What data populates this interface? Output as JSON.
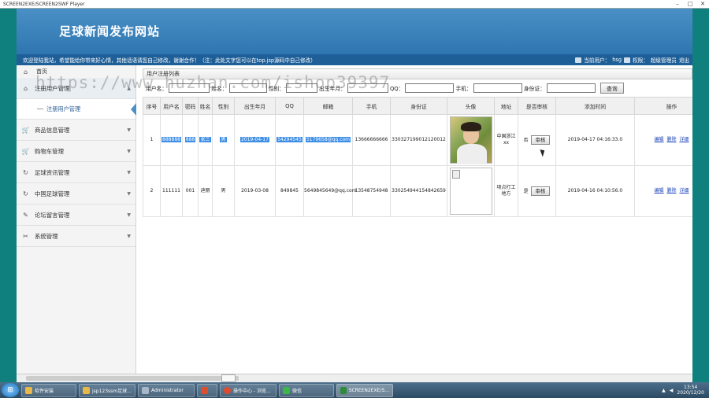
{
  "player": {
    "title": "SCREEN2EXE/SCREEN2SWF Player",
    "controls": [
      "–",
      "□",
      "✕"
    ]
  },
  "app": {
    "title": "足球新闻发布网站",
    "notice": "欢迎登陆我站，希望能给你带来好心情，其他话语请您自己修改，谢谢合作！（注：此处文字您可以在top.jsp源码中自己修改）",
    "current_user_label": "当前用户：",
    "current_user": "hsg",
    "permission_label": "权限：",
    "permission": "超级管理员",
    "logout": "退出"
  },
  "sidebar": {
    "home": "首页",
    "items": [
      {
        "label": "注册用户管理",
        "icon": "home-icon",
        "expanded": true
      },
      {
        "label": "商品信息管理",
        "icon": "cart-icon"
      },
      {
        "label": "购物车管理",
        "icon": "cart-icon"
      },
      {
        "label": "足球资讯管理",
        "icon": "refresh-icon"
      },
      {
        "label": "中国足球管理",
        "icon": "refresh-icon"
      },
      {
        "label": "论坛留言管理",
        "icon": "edit-icon"
      },
      {
        "label": "系统管理",
        "icon": "tools-icon"
      }
    ],
    "sub_item": "注册用户管理"
  },
  "main": {
    "panel_title": "用户注册列表",
    "search": {
      "fields": [
        {
          "label": "用户名：",
          "value": ""
        },
        {
          "label": "姓名：",
          "value": ""
        },
        {
          "label": "性别：",
          "value": ""
        },
        {
          "label": "出生年月：",
          "value": ""
        },
        {
          "label": "QQ：",
          "value": ""
        },
        {
          "label": "手机：",
          "value": ""
        },
        {
          "label": "身份证：",
          "value": ""
        }
      ],
      "button": "查询"
    },
    "columns": [
      "序号",
      "用户名",
      "密码",
      "姓名",
      "性别",
      "出生年月",
      "QQ",
      "邮箱",
      "手机",
      "身份证",
      "头像",
      "地址",
      "是否审核",
      "添加时间",
      "操作"
    ],
    "rows": [
      {
        "no": "1",
        "username": "888888",
        "password": "888",
        "name": "张三",
        "gender": "男",
        "birth": "2019-04-17",
        "qq": "54294545",
        "email": "5179658@qq.com",
        "phone": "13666666666",
        "idcard": "330327199012120012",
        "address": "中国浙江xx",
        "audit": "否",
        "audit_btn": "审核",
        "added": "2019-04-17 04:16:33.0",
        "actions": [
          "编辑",
          "删除",
          "详细"
        ]
      },
      {
        "no": "2",
        "username": "111111",
        "password": "001",
        "name": "迪丽",
        "gender": "男",
        "birth": "2019-03-08",
        "qq": "849845",
        "email": "5649845649@qq.com",
        "phone": "13548754948",
        "idcard": "330254944154842659",
        "address": "项点打工地方",
        "audit": "是",
        "audit_btn": "审核",
        "added": "2019-04-16 04:10:56.0",
        "actions": [
          "编辑",
          "删除",
          "详细"
        ]
      }
    ]
  },
  "watermark": "https://www.huzhan.com/ishop39397",
  "taskbar": {
    "tasks": [
      "软件安装",
      "jsp123ssm足球...",
      "Administrator",
      "",
      "操作中心 - 浏览...",
      "微信",
      "SCREEN2EXE/S..."
    ],
    "time": "13:54",
    "date": "2020/12/20"
  }
}
